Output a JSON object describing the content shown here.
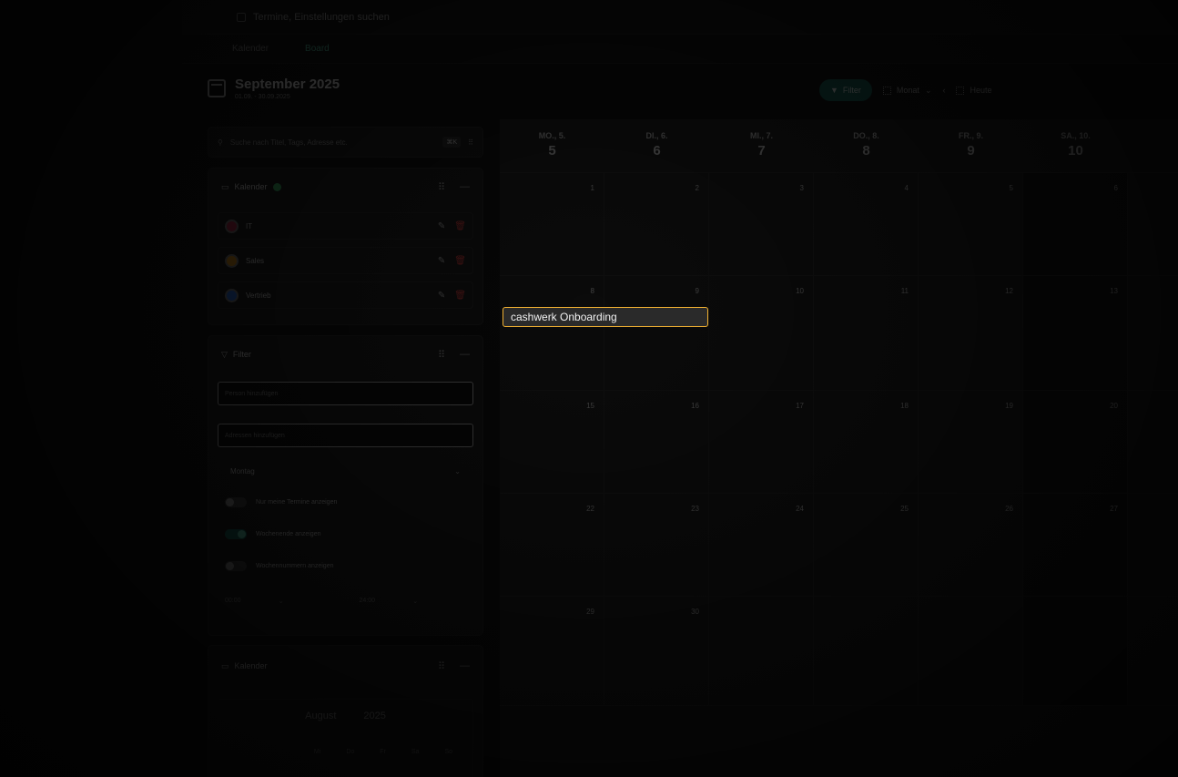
{
  "topbar": {
    "search_text": "Termine, Einstellungen suchen"
  },
  "navbar": {
    "items": [
      "Kalender",
      "Board"
    ]
  },
  "header": {
    "title": "September 2025",
    "subtitle": "01.09. - 30.09.2025"
  },
  "toolbar": {
    "filter_label": "Filter",
    "view_label": "Monat",
    "today_label": "Heute"
  },
  "search": {
    "placeholder": "Suche nach Titel, Tags, Adresse etc.",
    "shortcut": "⌘K"
  },
  "kalender": {
    "title": "Kalender",
    "items": [
      {
        "label": "IT",
        "color": "#b02a4a"
      },
      {
        "label": "Sales",
        "color": "#d08a1a"
      },
      {
        "label": "Vertrieb",
        "color": "#2a6ad0"
      }
    ]
  },
  "filter": {
    "title": "Filter",
    "input1_placeholder": "Person hinzufügen",
    "input2_placeholder": "Adressen hinzufügen",
    "week_start": "Montag",
    "toggles": [
      {
        "label": "Nur meine Termine anzeigen",
        "on": false
      },
      {
        "label": "Wochenende anzeigen",
        "on": true
      },
      {
        "label": "Wochennummern anzeigen",
        "on": false
      }
    ],
    "from_label": "00:00",
    "to_label": "24:00"
  },
  "minical": {
    "title": "Kalender",
    "month": "August",
    "year": "2025",
    "dows": [
      "Mi",
      "Do",
      "Fr",
      "Sa",
      "So"
    ]
  },
  "calendar": {
    "day_headers": [
      {
        "dow": "MO., 5.",
        "num": "5"
      },
      {
        "dow": "DI., 6.",
        "num": "6"
      },
      {
        "dow": "MI., 7.",
        "num": "7"
      },
      {
        "dow": "DO., 8.",
        "num": "8"
      },
      {
        "dow": "FR., 9.",
        "num": "9"
      },
      {
        "dow": "SA., 10.",
        "num": "10"
      }
    ],
    "weeks": [
      [
        "1",
        "2",
        "3",
        "4",
        "5",
        "6"
      ],
      [
        "8",
        "9",
        "10",
        "11",
        "12",
        "13"
      ],
      [
        "15",
        "16",
        "17",
        "18",
        "19",
        "20"
      ],
      [
        "22",
        "23",
        "24",
        "25",
        "26",
        "27"
      ],
      [
        "29",
        "30",
        "",
        "",
        "",
        ""
      ]
    ],
    "event": {
      "title": "cashwerk Onboarding"
    }
  }
}
